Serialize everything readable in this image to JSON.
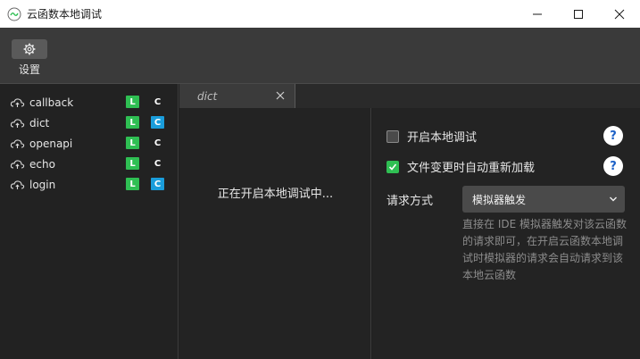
{
  "window": {
    "title": "云函数本地调试",
    "minimize_glyph": "─",
    "maximize_glyph": "☐",
    "close_glyph": "✕"
  },
  "toolbar": {
    "settings_label": "设置",
    "settings_icon": "gear-icon"
  },
  "sidebar": {
    "functions": [
      {
        "name": "callback",
        "badge_l": "L",
        "badge_c": "C",
        "c_active": false
      },
      {
        "name": "dict",
        "badge_l": "L",
        "badge_c": "C",
        "c_active": true
      },
      {
        "name": "openapi",
        "badge_l": "L",
        "badge_c": "C",
        "c_active": false
      },
      {
        "name": "echo",
        "badge_l": "L",
        "badge_c": "C",
        "c_active": false
      },
      {
        "name": "login",
        "badge_l": "L",
        "badge_c": "C",
        "c_active": true
      }
    ]
  },
  "tabs": [
    {
      "label": "dict"
    }
  ],
  "log": {
    "status_text": "正在开启本地调试中..."
  },
  "settings": {
    "enable_local_debug": {
      "label": "开启本地调试",
      "checked": false
    },
    "auto_reload": {
      "label": "文件变更时自动重新加载",
      "checked": true
    },
    "help_glyph": "?",
    "request_mode_label": "请求方式",
    "request_mode_value": "模拟器触发",
    "request_mode_desc": "直接在 IDE 模拟器触发对该云函数的请求即可，在开启云函数本地调试时模拟器的请求会自动请求到该本地云函数"
  },
  "colors": {
    "badge_l": "#2fbf53",
    "badge_c_active": "#1a9ddb",
    "checkbox_checked": "#2fbf53",
    "help_question": "#1a5fc7"
  }
}
